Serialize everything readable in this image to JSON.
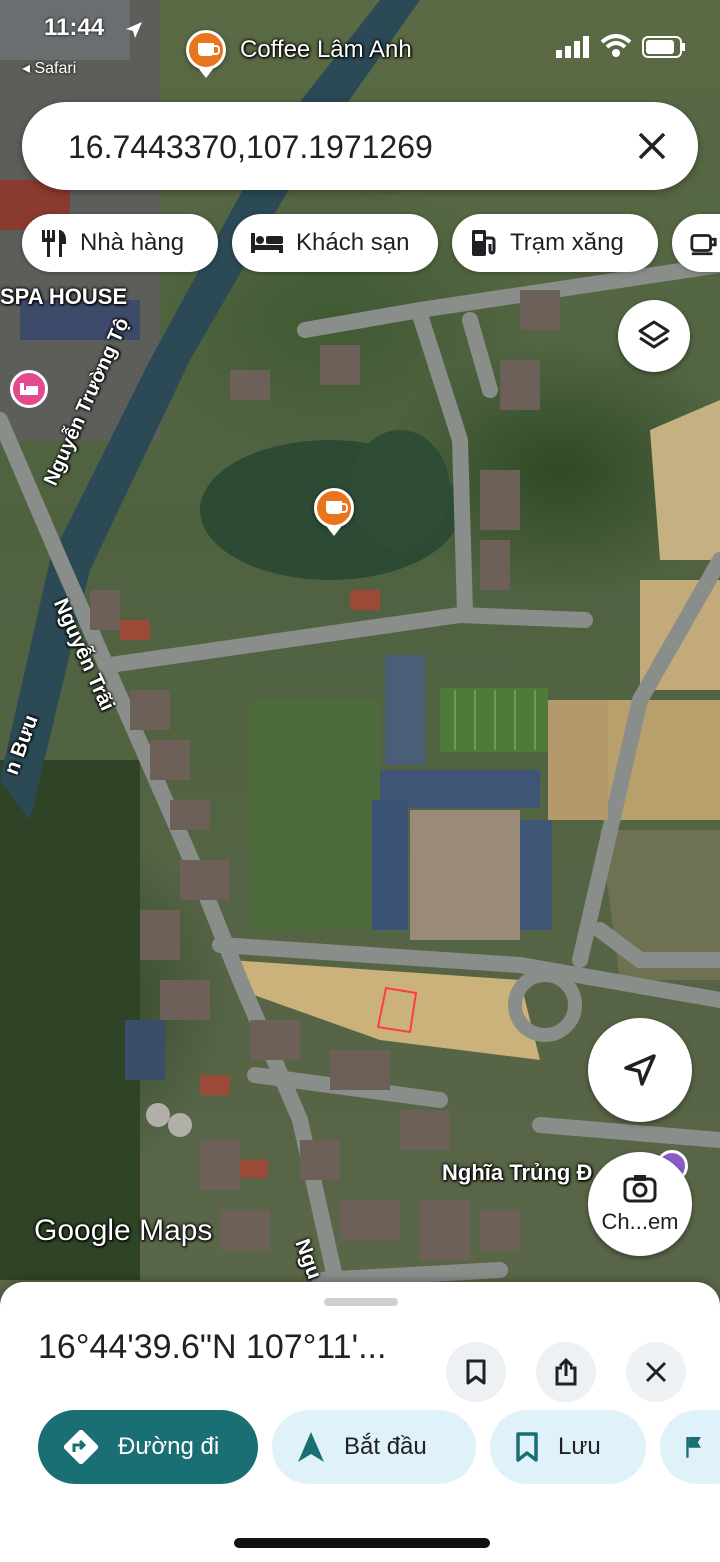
{
  "status_bar": {
    "time": "11:44",
    "back_label": "◂ Safari"
  },
  "map": {
    "top_poi_label": "Coffee Lâm Anh",
    "labels": {
      "spa": "SPA HOUSE",
      "street_truong_to": "Nguyễn Trường Tộ",
      "street_trai": "Nguyễn Trãi",
      "street_buu": "n Bưu",
      "cemetery": "Nghĩa Trủng Đ",
      "street_bottom": "Ngu",
      "watermark": "Google Maps"
    },
    "accent_poi_color": "#e8741e",
    "hotel_pin_color": "#e24a8d",
    "marked_parcel_color": "#ff3b4a"
  },
  "search": {
    "query": "16.7443370,107.1971269"
  },
  "chips": [
    {
      "label": "Nhà hàng",
      "icon": "restaurant-icon"
    },
    {
      "label": "Khách sạn",
      "icon": "hotel-icon"
    },
    {
      "label": "Trạm xăng",
      "icon": "gas-station-icon"
    },
    {
      "label": "",
      "icon": "coffee-icon"
    }
  ],
  "fabs": {
    "layers_icon": "layers-icon",
    "location_icon": "navigation-arrow-icon",
    "lens_label": "Ch...em"
  },
  "sheet": {
    "title": "16°44'39.6\"N 107°11'...",
    "actions": [
      {
        "label": "Đường đi",
        "icon": "directions-icon"
      },
      {
        "label": "Bắt đầu",
        "icon": "navigation-icon"
      },
      {
        "label": "Lưu",
        "icon": "bookmark-icon"
      },
      {
        "label": "",
        "icon": "flag-icon"
      }
    ],
    "primary_color": "#1a6f75",
    "secondary_bg": "#dff1f9"
  }
}
